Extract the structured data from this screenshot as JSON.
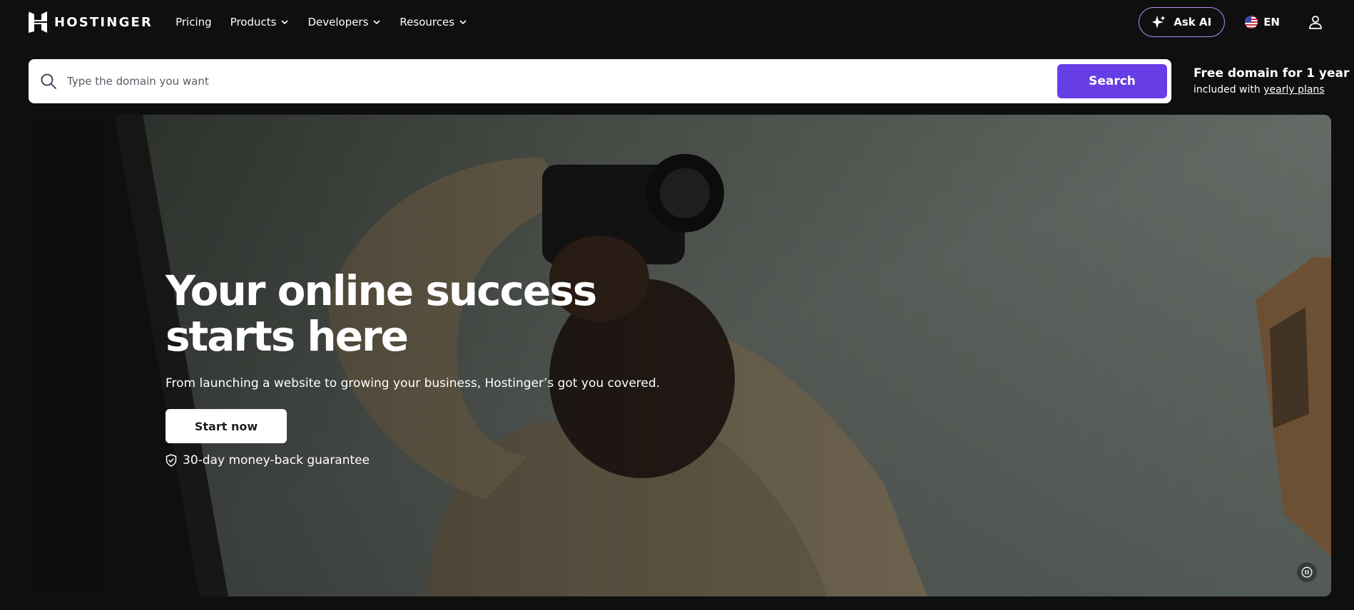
{
  "nav": {
    "logo_text": "HOSTINGER",
    "items": [
      {
        "label": "Pricing",
        "has_dropdown": false
      },
      {
        "label": "Products",
        "has_dropdown": true
      },
      {
        "label": "Developers",
        "has_dropdown": true
      },
      {
        "label": "Resources",
        "has_dropdown": true
      }
    ],
    "ask_ai_label": "Ask AI",
    "language": "EN"
  },
  "search": {
    "placeholder": "Type the domain you want",
    "button_label": "Search"
  },
  "promo": {
    "title": "Free domain for 1 year",
    "sub_prefix": "included with ",
    "link": "yearly plans"
  },
  "hero": {
    "title": "Your online success starts here",
    "subtitle": "From launching a website to growing your business, Hostinger’s got you covered.",
    "cta_label": "Start now",
    "guarantee": "30-day money-back guarantee"
  },
  "colors": {
    "background": "#0f0f10",
    "accent_purple": "#673de6",
    "ask_ai_border": "#b98cf0"
  },
  "icons": [
    "hostinger-logo-icon",
    "chevron-down-icon",
    "sparkle-icon",
    "us-flag-icon",
    "user-icon",
    "search-icon",
    "shield-check-icon",
    "pause-icon"
  ]
}
